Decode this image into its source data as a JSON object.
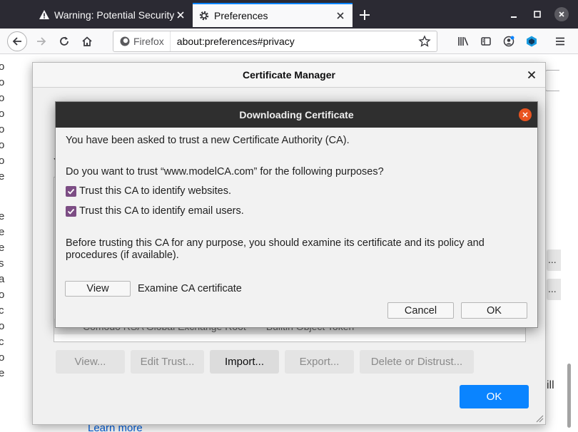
{
  "browser": {
    "tabs": [
      {
        "title": "Warning: Potential Security Risk Ahead",
        "icon": "warning-icon"
      },
      {
        "title": "Preferences",
        "icon": "gear-icon"
      }
    ],
    "identity_label": "Firefox",
    "url": "about:preferences#privacy",
    "accent_color": "#0a84ff"
  },
  "cert_manager": {
    "title": "Certificate Manager",
    "partial_text": "Y",
    "list_row": {
      "col1": "Comodo RSA Global Exchange Root",
      "col2": "Builtin Object Token"
    },
    "buttons": {
      "view": "View...",
      "edit_trust": "Edit Trust...",
      "import": "Import...",
      "export": "Export...",
      "delete": "Delete or Distrust..."
    },
    "ok_label": "OK"
  },
  "download_dialog": {
    "title": "Downloading Certificate",
    "intro": "You have been asked to trust a new Certificate Authority (CA).",
    "question": "Do you want to trust “www.modelCA.com” for the following purposes?",
    "options": [
      {
        "label": "Trust this CA to identify websites.",
        "checked": true
      },
      {
        "label": "Trust this CA to identify email users.",
        "checked": true
      }
    ],
    "advice": "Before trusting this CA for any purpose, you should examine its certificate and its policy and procedures (if available).",
    "view_label": "View",
    "view_desc": "Examine CA certificate",
    "cancel_label": "Cancel",
    "ok_label": "OK"
  },
  "background": {
    "learn_more": "Learn more",
    "right_text": "ill",
    "ellipsis": "..."
  }
}
